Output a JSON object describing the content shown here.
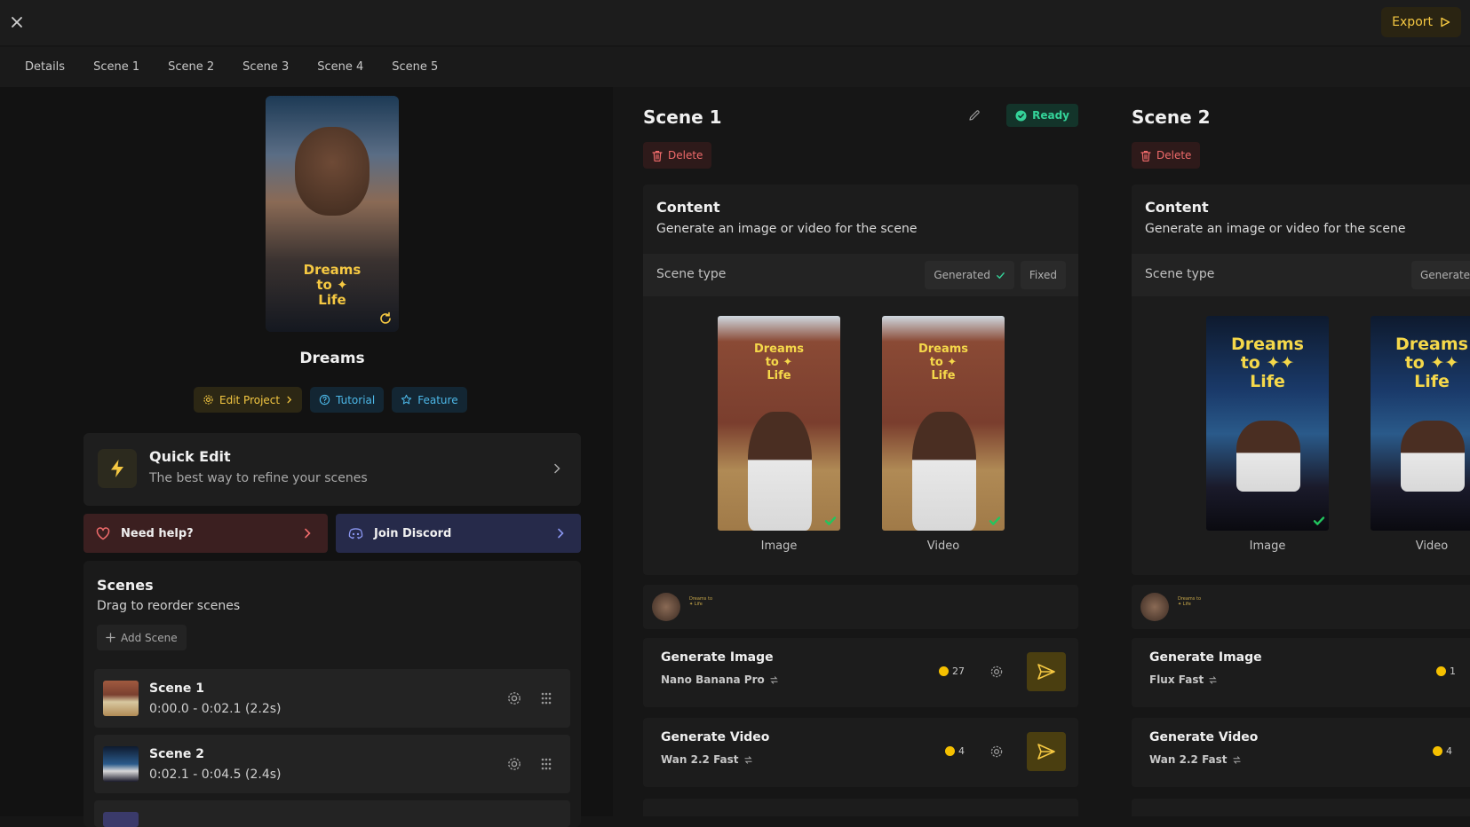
{
  "topbar": {
    "export_label": "Export"
  },
  "tabs": [
    "Details",
    "Scene 1",
    "Scene 2",
    "Scene 3",
    "Scene 4",
    "Scene 5"
  ],
  "project": {
    "poster_title_line1": "Dreams",
    "poster_title_line2": "to ✦",
    "poster_title_line3": "Life",
    "name": "Dreams",
    "edit_label": "Edit Project",
    "tutorial_label": "Tutorial",
    "feature_label": "Feature"
  },
  "quick_edit": {
    "title": "Quick Edit",
    "subtitle": "The best way to refine your scenes"
  },
  "help": {
    "need_help": "Need help?",
    "discord": "Join Discord"
  },
  "scenes_panel": {
    "title": "Scenes",
    "subtitle": "Drag to reorder scenes",
    "add_label": "Add Scene",
    "items": [
      {
        "name": "Scene 1",
        "time": "0:00.0 - 0:02.1  (2.2s)"
      },
      {
        "name": "Scene 2",
        "time": "0:02.1 - 0:04.5  (2.4s)"
      }
    ]
  },
  "scene1": {
    "title": "Scene 1",
    "status": "Ready",
    "delete_label": "Delete",
    "content_title": "Content",
    "content_sub": "Generate an image or video for the scene",
    "scene_type_label": "Scene type",
    "generated_label": "Generated",
    "fixed_label": "Fixed",
    "image_label": "Image",
    "video_label": "Video",
    "media_text_line1": "Dreams",
    "media_text_line2": "to ✦",
    "media_text_line3": "Life",
    "ref_mini_text": "Dreams to ✦ Life",
    "gen_image_title": "Generate Image",
    "gen_image_model": "Nano Banana Pro",
    "gen_image_cost": "27",
    "gen_video_title": "Generate Video",
    "gen_video_model": "Wan 2.2 Fast",
    "gen_video_cost": "4"
  },
  "scene2": {
    "title": "Scene 2",
    "delete_label": "Delete",
    "content_title": "Content",
    "content_sub": "Generate an image or video for the scene",
    "scene_type_label": "Scene type",
    "generated_label": "Generate",
    "image_label": "Image",
    "video_label": "Video",
    "media_text_line1": "Dreams",
    "media_text_line2": "to ✦✦",
    "media_text_line3": "Life",
    "media_text_b_line1": "Dreams",
    "media_text_b_line2": "to ✦✦",
    "media_text_b_line3": "Life",
    "ref_mini_text": "Dreams to ✦ Life",
    "gen_image_title": "Generate Image",
    "gen_image_model": "Flux Fast",
    "gen_image_cost": "1",
    "gen_video_title": "Generate Video",
    "gen_video_model": "Wan 2.2 Fast",
    "gen_video_cost": "4"
  },
  "colors": {
    "accent": "#f5c842",
    "ready": "#34d399",
    "danger": "#f06b6b",
    "link": "#4db8e8"
  }
}
